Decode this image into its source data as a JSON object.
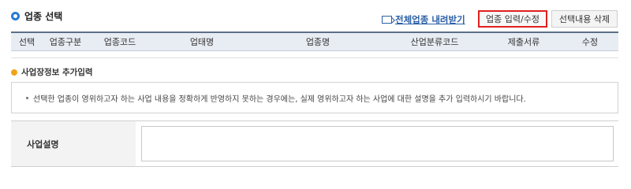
{
  "section": {
    "title": "업종 선택"
  },
  "download": {
    "label": "전체업종 내려받기"
  },
  "buttons": {
    "edit": "업종 입력/수정",
    "delete": "선택내용 삭제"
  },
  "table": {
    "columns": [
      "선택",
      "업종구분",
      "업종코드",
      "업태명",
      "업종명",
      "산업분류코드",
      "제출서류",
      "수정"
    ]
  },
  "subsection": {
    "title": "사업장정보 추가입력"
  },
  "info": {
    "text": "선택한 업종이 영위하고자 하는 사업 내용을 정확하게 반영하지 못하는 경우에는, 실제 영위하고자 하는 사업에 대한 설명을 추가 입력하시기 바랍니다."
  },
  "form": {
    "label": "사업설명",
    "value": ""
  },
  "colors": {
    "accent_blue": "#2a7bd0",
    "highlight_red": "#e02020",
    "orange": "#f0a31a"
  }
}
